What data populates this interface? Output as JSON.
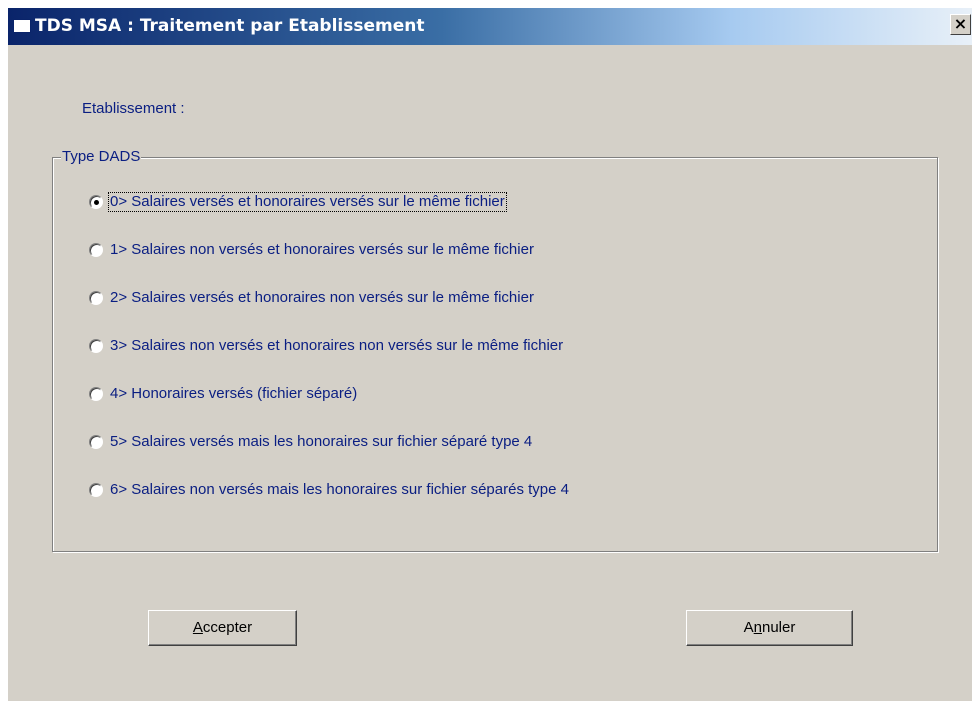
{
  "window": {
    "title": "TDS MSA : Traitement par Etablissement",
    "close_glyph": "×"
  },
  "form": {
    "etablissement_label": "Etablissement :"
  },
  "group": {
    "legend": "Type DADS",
    "options": [
      {
        "label": "0> Salaires versés et honoraires versés sur le même fichier",
        "checked": true
      },
      {
        "label": "1> Salaires non versés et honoraires versés sur le même fichier",
        "checked": false
      },
      {
        "label": "2> Salaires versés et honoraires non versés sur le même fichier",
        "checked": false
      },
      {
        "label": "3> Salaires non versés et honoraires non versés sur le même fichier",
        "checked": false
      },
      {
        "label": "4> Honoraires versés (fichier séparé)",
        "checked": false
      },
      {
        "label": "5> Salaires versés mais les honoraires sur fichier séparé type 4",
        "checked": false
      },
      {
        "label": "6> Salaires non versés mais les honoraires sur fichier séparés type 4",
        "checked": false
      }
    ]
  },
  "buttons": {
    "accept": {
      "mnemonic": "A",
      "rest": "ccepter"
    },
    "cancel": {
      "before": "A",
      "mnemonic": "n",
      "rest": "nuler"
    }
  },
  "colors": {
    "face": "#d4d0c8",
    "title_start": "#0a246a",
    "title_end": "#a6caf0",
    "label_text": "#0a1e82"
  }
}
